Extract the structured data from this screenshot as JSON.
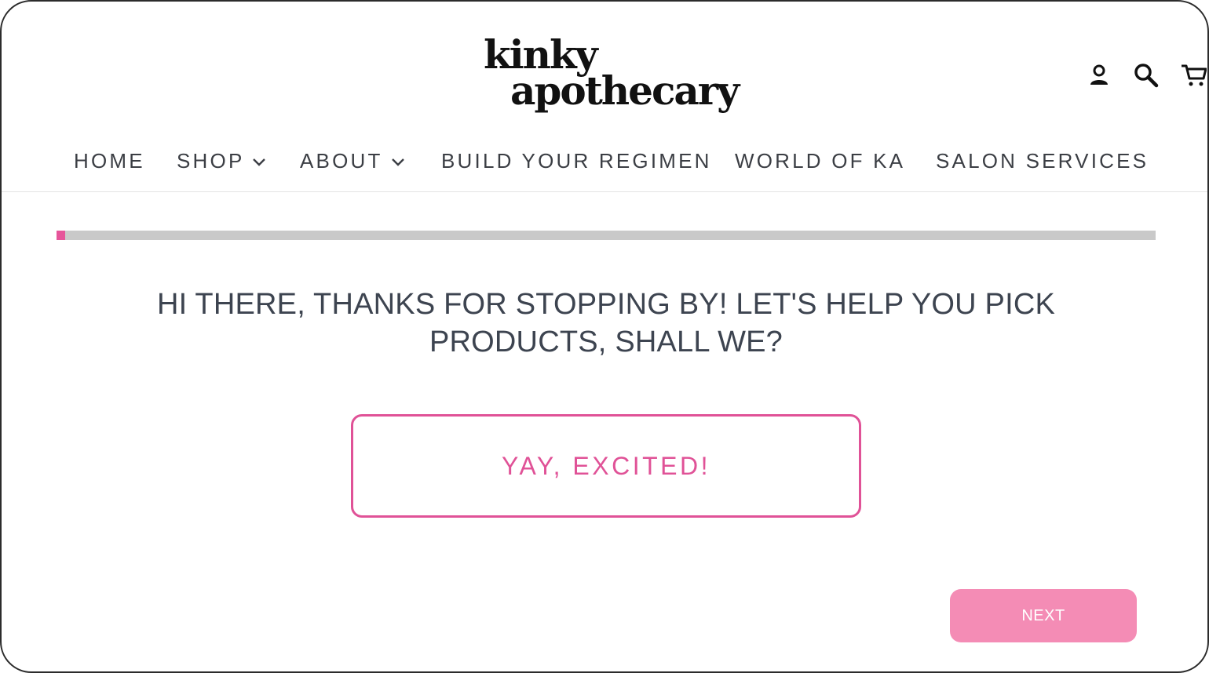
{
  "brand": {
    "logo_line1": "kinky",
    "logo_line2": "apothecary"
  },
  "header_icons": [
    "account-icon",
    "search-icon",
    "cart-icon"
  ],
  "nav": {
    "items": [
      {
        "label": "HOME",
        "has_dropdown": false
      },
      {
        "label": "SHOP",
        "has_dropdown": true
      },
      {
        "label": "ABOUT",
        "has_dropdown": true
      },
      {
        "label": "BUILD YOUR REGIMEN",
        "has_dropdown": false
      },
      {
        "label": "WORLD OF KA",
        "has_dropdown": false
      },
      {
        "label": "SALON SERVICES",
        "has_dropdown": false
      }
    ]
  },
  "quiz": {
    "progress_fraction": 0.008,
    "question_line1": "HI THERE, THANKS FOR STOPPING BY! LET'S HELP YOU PICK",
    "question_line2": "PRODUCTS, SHALL WE?",
    "answer_label": "YAY, EXCITED!",
    "next_label": "NEXT"
  },
  "colors": {
    "accent": "#e05297",
    "progress_fill": "#e6559a",
    "progress_track": "#c9c9c9",
    "next_button": "#f48cb5",
    "text": "#3d4450"
  }
}
